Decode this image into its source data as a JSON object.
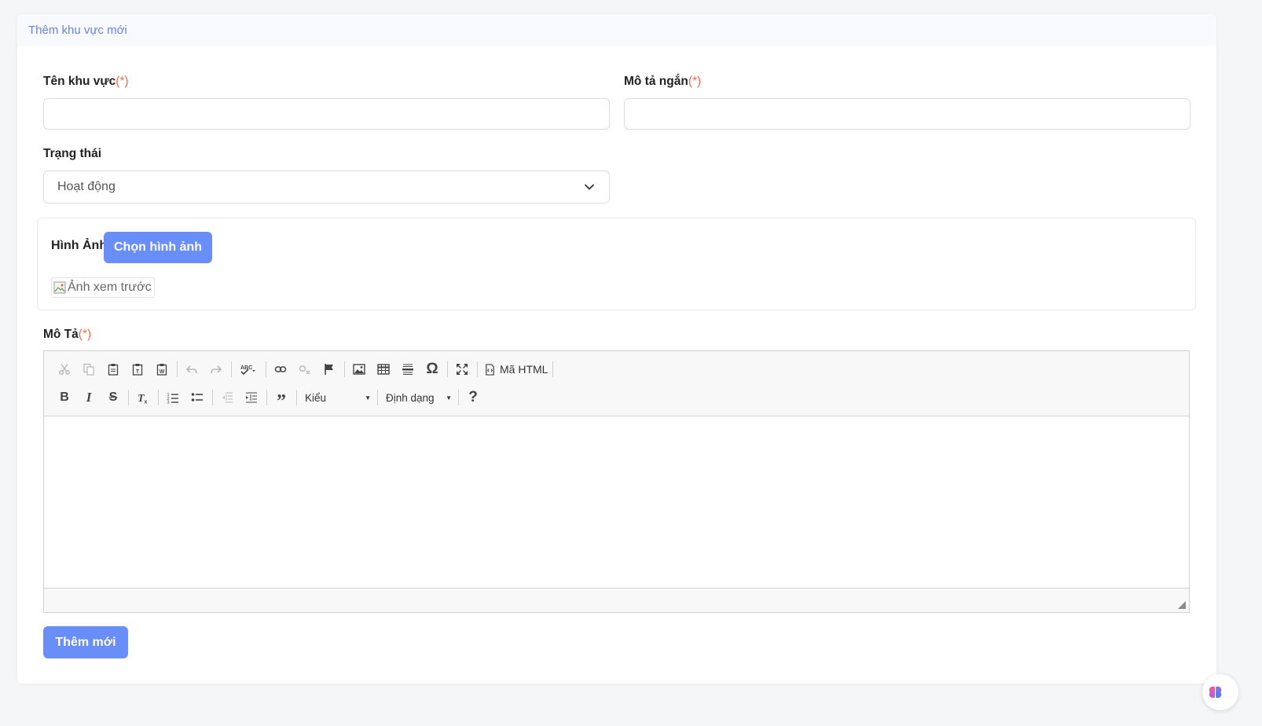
{
  "header": {
    "title": "Thêm khu vực mới"
  },
  "form": {
    "name_label": "Tên khu vực",
    "short_desc_label": "Mô tả ngắn",
    "required_mark": "(*)",
    "name_value": "",
    "short_desc_value": "",
    "status_label": "Trạng thái",
    "status_selected": "Hoạt động",
    "image_label": "Hình Ảnh",
    "choose_image_button": "Chọn hình ảnh",
    "preview_alt": "Ảnh xem trước",
    "description_label": "Mô Tả",
    "submit_button": "Thêm mới"
  },
  "editor": {
    "source_button": "Mã HTML",
    "styles_combo": "Kiểu",
    "format_combo": "Định dạng",
    "help_icon_text": "?",
    "toolbar_row1_icons": [
      "cut-icon",
      "copy-icon",
      "paste-icon",
      "paste-text-icon",
      "paste-word-icon",
      "undo-icon",
      "redo-icon",
      "spellcheck-icon",
      "link-icon",
      "unlink-icon",
      "anchor-icon",
      "image-icon",
      "table-icon",
      "horizontal-rule-icon",
      "special-char-icon",
      "maximize-icon",
      "source-icon"
    ],
    "toolbar_row2_icons": [
      "bold-icon",
      "italic-icon",
      "strike-icon",
      "remove-format-icon",
      "numbered-list-icon",
      "bulleted-list-icon",
      "outdent-icon",
      "indent-icon",
      "blockquote-icon",
      "help-icon"
    ]
  },
  "colors": {
    "accent": "#6a8ef7",
    "header_text": "#6a82ea",
    "required": "#f0694b"
  }
}
